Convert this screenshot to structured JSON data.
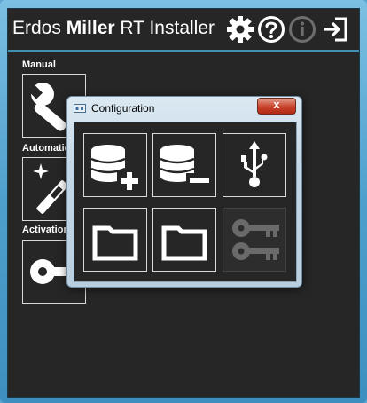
{
  "window": {
    "title_prefix": "Erdos ",
    "title_bold": "Miller",
    "title_suffix": " RT Installer"
  },
  "header_icons": [
    "gear-icon",
    "help-icon",
    "info-icon",
    "exit-icon"
  ],
  "sections": [
    {
      "label": "Manual",
      "icon": "wrench-icon"
    },
    {
      "label": "Automation",
      "icon": "magic-wand-icon"
    },
    {
      "label": "Activation",
      "icon": "key-icon"
    }
  ],
  "dialog": {
    "title": "Configuration",
    "close_label": "x",
    "tiles": [
      {
        "icon": "database-add-icon",
        "enabled": true
      },
      {
        "icon": "database-remove-icon",
        "enabled": true
      },
      {
        "icon": "usb-icon",
        "enabled": true
      },
      {
        "icon": "folder-icon",
        "enabled": true
      },
      {
        "icon": "folder-icon",
        "enabled": true
      },
      {
        "icon": "keys-icon",
        "enabled": false
      }
    ]
  },
  "colors": {
    "background": "#262626",
    "accent": "#3f8fb6",
    "tile_border": "#d9d9d9",
    "close_button": "#c7422b"
  }
}
